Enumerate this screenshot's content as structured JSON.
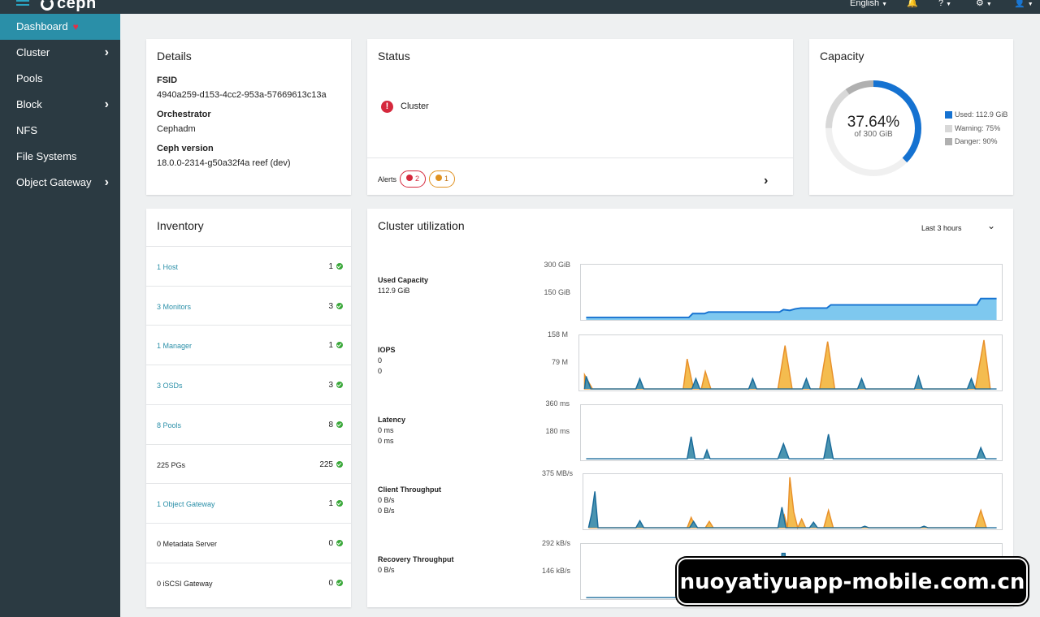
{
  "topbar": {
    "brand": "ceph",
    "language": "English"
  },
  "sidebar": {
    "items": [
      {
        "label": "Dashboard",
        "active": true
      },
      {
        "label": "Cluster",
        "chevron": true
      },
      {
        "label": "Pools"
      },
      {
        "label": "Block",
        "chevron": true
      },
      {
        "label": "NFS"
      },
      {
        "label": "File Systems"
      },
      {
        "label": "Object Gateway",
        "chevron": true
      }
    ]
  },
  "details": {
    "title": "Details",
    "fsid_label": "FSID",
    "fsid": "4940a259-d153-4cc2-953a-57669613c13a",
    "orch_label": "Orchestrator",
    "orch": "Cephadm",
    "version_label": "Ceph version",
    "version": "18.0.0-2314-g50a32f4a reef (dev)"
  },
  "status": {
    "title": "Status",
    "item": "Cluster",
    "alerts_label": "Alerts",
    "alert_error_count": "2",
    "alert_warn_count": "1"
  },
  "capacity": {
    "title": "Capacity",
    "percent": "37.64%",
    "of": "of 300 GiB",
    "used_fraction": 0.3764,
    "warning_fraction": 0.75,
    "danger_fraction": 0.9,
    "legend": {
      "used": "Used: 112.9 GiB",
      "warning": "Warning: 75%",
      "danger": "Danger: 90%"
    },
    "colors": {
      "used": "#1572d1",
      "warning": "#d8d8d8",
      "danger": "#b0b0b0"
    }
  },
  "inventory": {
    "title": "Inventory",
    "rows": [
      {
        "name": "1 Host",
        "count": "1",
        "link": true
      },
      {
        "name": "3 Monitors",
        "count": "3",
        "link": true
      },
      {
        "name": "1 Manager",
        "count": "1",
        "link": true
      },
      {
        "name": "3 OSDs",
        "count": "3",
        "link": true
      },
      {
        "name": "8 Pools",
        "count": "8",
        "link": true
      },
      {
        "name": "225 PGs",
        "count": "225",
        "link": false
      },
      {
        "name": "1 Object Gateway",
        "count": "1",
        "link": true
      },
      {
        "name": "0 Metadata Server",
        "count": "0",
        "link": false
      },
      {
        "name": "0 iSCSI Gateway",
        "count": "0",
        "link": false
      }
    ]
  },
  "utilization": {
    "title": "Cluster utilization",
    "range": "Last 3 hours",
    "metrics": [
      {
        "label": "Used Capacity",
        "values": [
          "112.9 GiB"
        ],
        "ticks": [
          "300 GiB",
          "150 GiB"
        ]
      },
      {
        "label": "IOPS",
        "values": [
          "0",
          "0"
        ],
        "ticks": [
          "158 M",
          "79 M"
        ]
      },
      {
        "label": "Latency",
        "values": [
          "0 ms",
          "0 ms"
        ],
        "ticks": [
          "360 ms",
          "180 ms"
        ]
      },
      {
        "label": "Client Throughput",
        "values": [
          "0 B/s",
          "0 B/s"
        ],
        "ticks": [
          "375 MB/s",
          ""
        ]
      },
      {
        "label": "Recovery Throughput",
        "values": [
          "0 B/s"
        ],
        "ticks": [
          "292 kB/s",
          "146 kB/s"
        ]
      }
    ]
  },
  "watermark": "nuoyatiyuapp-mobile.com.cn"
}
